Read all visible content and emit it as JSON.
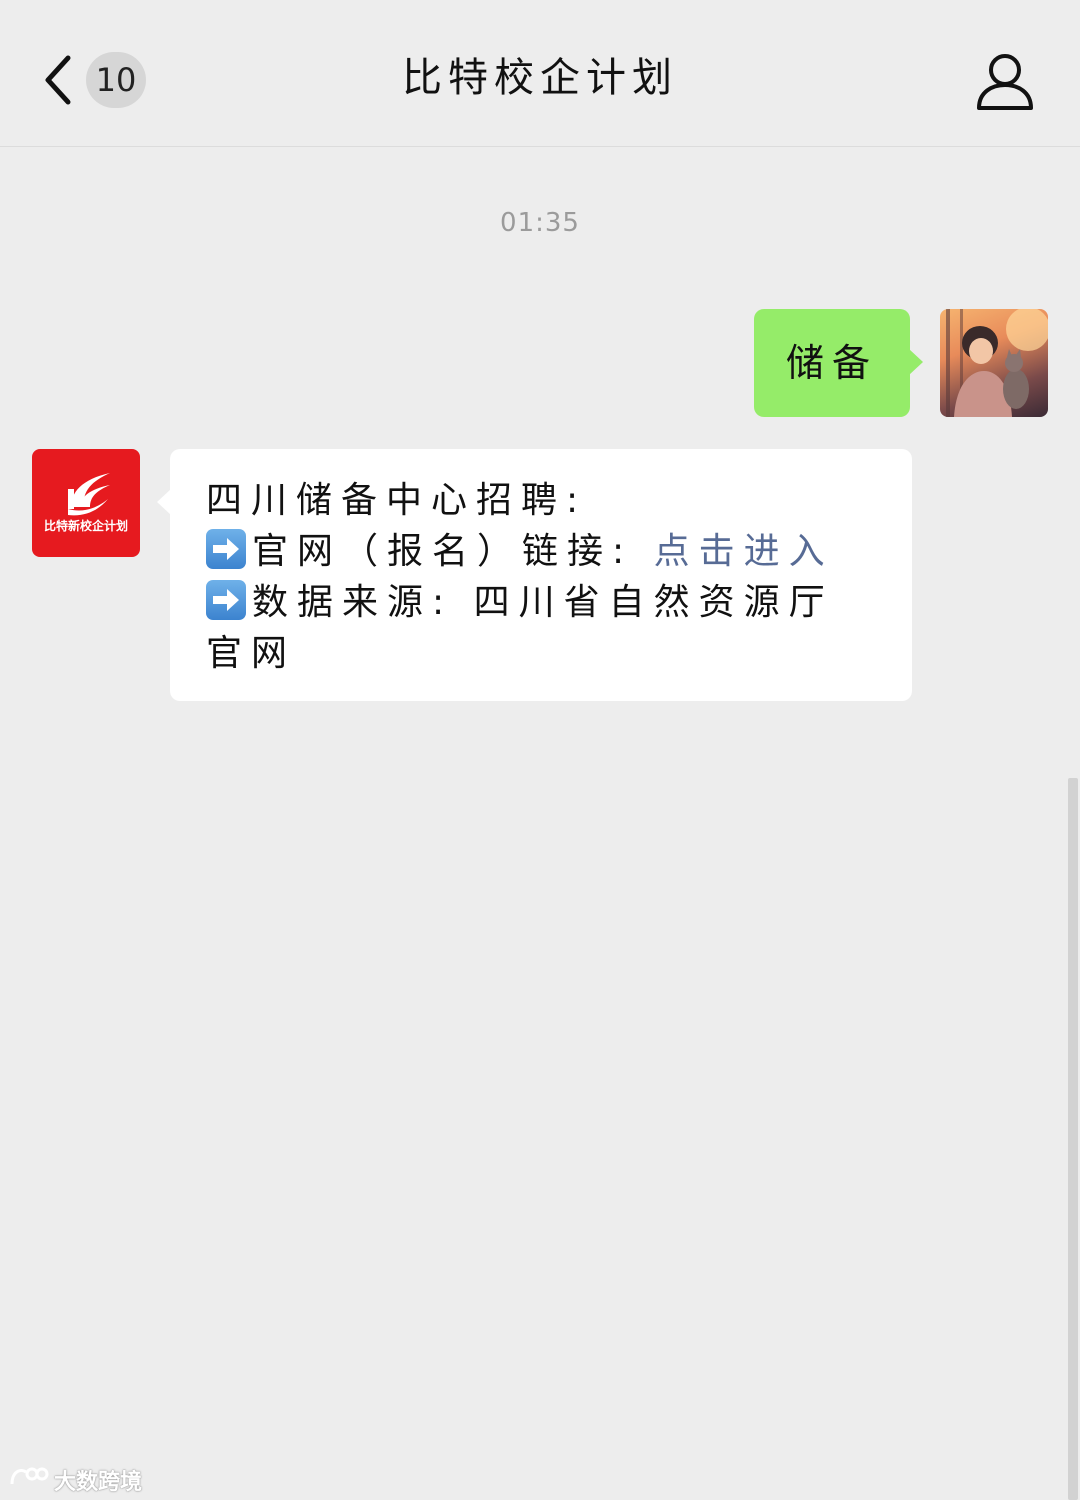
{
  "header": {
    "back_icon": "chevron-left-icon",
    "unread_count": "10",
    "title": "比特校企计划",
    "profile_icon": "person-icon"
  },
  "chat": {
    "timestamp": "01:35",
    "messages": [
      {
        "direction": "sent",
        "text": "储备",
        "bubble_color": "#95ec69"
      },
      {
        "direction": "received",
        "avatar_text": "比特新校企计划",
        "avatar_color": "#e61a1f",
        "lines": [
          {
            "text": "四川储备中心招聘:"
          },
          {
            "icon": "arrow-right-icon",
            "text": "官网（报名）链接: ",
            "link": "点击进入"
          },
          {
            "icon": "arrow-right-icon",
            "text": "数据来源: 四川省自然资源厅"
          },
          {
            "text": "官网"
          }
        ],
        "link_color": "#576b95"
      }
    ]
  },
  "watermark": {
    "text": "大数跨境"
  }
}
